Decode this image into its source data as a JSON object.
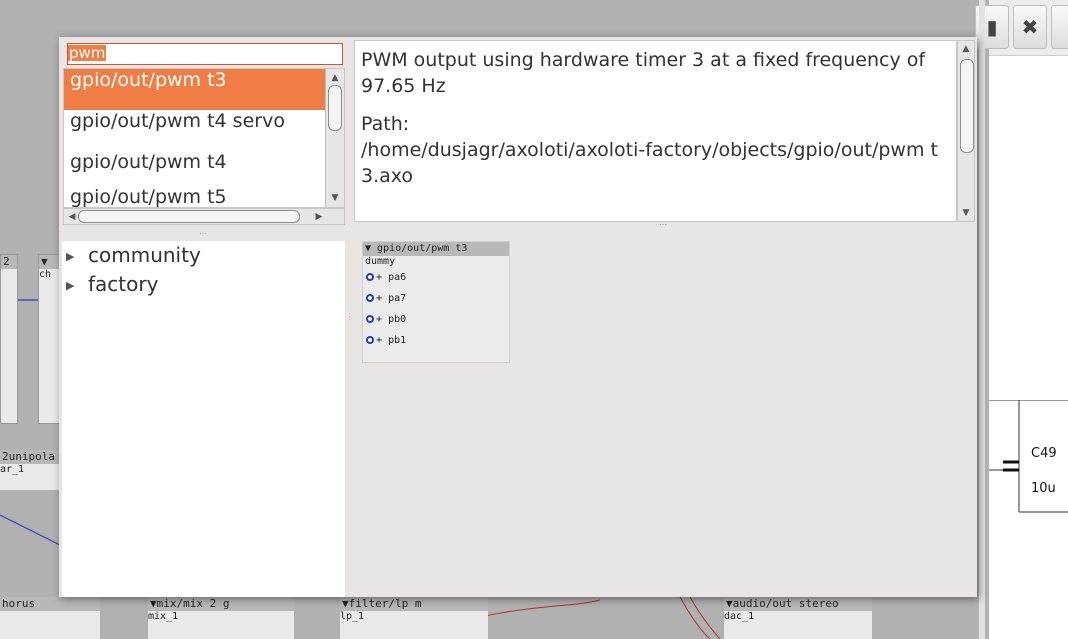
{
  "popup": {
    "search": {
      "value": "pwm"
    },
    "results": [
      {
        "label": "gpio/out/pwm t3",
        "selected": true
      },
      {
        "label": "gpio/out/pwm t4 servo",
        "selected": false
      },
      {
        "label": "gpio/out/pwm t4",
        "selected": false
      },
      {
        "label": "gpio/out/pwm t5",
        "selected": false
      }
    ],
    "description": {
      "text": "PWM output using hardware timer 3 at a fixed frequency of 97.65 Hz",
      "path_label": "Path:",
      "path": "/home/dusjagr/axoloti/axoloti-factory/objects/gpio/out/pwm t3.axo"
    },
    "tree": [
      {
        "label": "community"
      },
      {
        "label": "factory"
      }
    ],
    "preview": {
      "header": "gpio/out/pwm t3",
      "instance": "dummy",
      "outlets": [
        "pa6",
        "pa7",
        "pb0",
        "pb1"
      ],
      "plus": "+"
    }
  },
  "background": {
    "left_blocks": [
      {
        "header": "2",
        "name": ""
      },
      {
        "header": "",
        "name": "ch"
      },
      {
        "header": "2unipola",
        "name": "ar_1"
      }
    ],
    "bottom_objects": [
      {
        "header": "horus",
        "name": ""
      },
      {
        "header": "mix/mix 2 g",
        "name": "mix_1"
      },
      {
        "header": "filter/lp m",
        "name": "lp_1"
      },
      {
        "header": "audio/out stereo",
        "name": "dac_1"
      }
    ]
  },
  "schematic": {
    "component_ref": "C49",
    "component_value": "10u"
  },
  "colors": {
    "accent": "#f07d46",
    "jack": "#1a3ad0",
    "wire_blue": "#2a3fb8",
    "wire_red": "#b03030"
  }
}
